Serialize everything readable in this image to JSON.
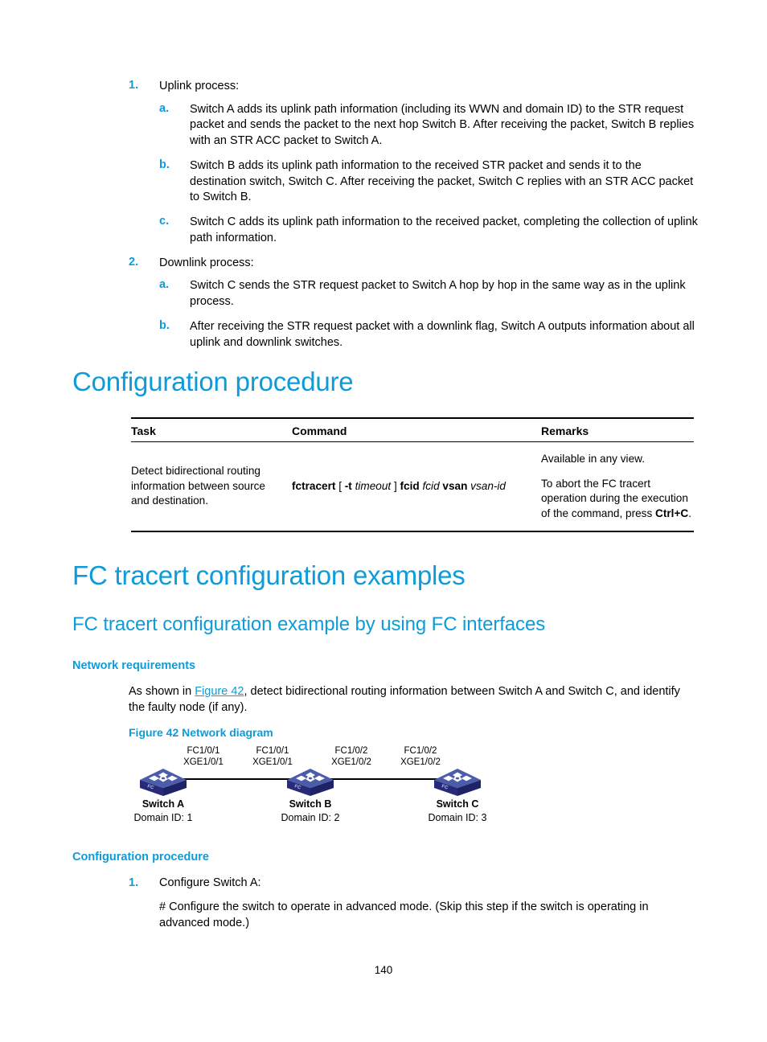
{
  "page": {
    "number": "140"
  },
  "steps_list": [
    {
      "marker": "1.",
      "text": "Uplink process:",
      "sub": [
        {
          "marker": "a.",
          "text": "Switch A adds its uplink path information (including its WWN and domain ID) to the STR request packet and sends the packet to the next hop Switch B. After receiving the packet, Switch B replies with an STR ACC packet to Switch A."
        },
        {
          "marker": "b.",
          "text": "Switch B adds its uplink path information to the received STR packet and sends it to the destination switch, Switch C. After receiving the packet, Switch C replies with an STR ACC packet to Switch B."
        },
        {
          "marker": "c.",
          "text": "Switch C adds its uplink path information to the received packet, completing the collection of uplink path information."
        }
      ]
    },
    {
      "marker": "2.",
      "text": "Downlink process:",
      "sub": [
        {
          "marker": "a.",
          "text": "Switch C sends the STR request packet to Switch A hop by hop in the same way as in the uplink process."
        },
        {
          "marker": "b.",
          "text": "After receiving the STR request packet with a downlink flag, Switch A outputs information about all uplink and downlink switches."
        }
      ]
    }
  ],
  "headings": {
    "config_procedure_1": "Configuration procedure",
    "fc_tracert_examples": "FC tracert configuration examples",
    "fc_tracert_example_fc": "FC tracert configuration example by using FC interfaces",
    "network_requirements": "Network requirements",
    "config_procedure_2": "Configuration procedure"
  },
  "table": {
    "headers": {
      "task": "Task",
      "command": "Command",
      "remarks": "Remarks"
    },
    "row": {
      "task": "Detect bidirectional routing information between source and destination.",
      "command": {
        "cmd": "fctracert",
        "open_bracket": "[",
        "opt_flag": "-t",
        "opt_value": "timeout",
        "close_bracket": "]",
        "kw_fcid": "fcid",
        "val_fcid": "fcid",
        "kw_vsan": "vsan",
        "val_vsan": "vsan-id"
      },
      "remarks": {
        "line1": "Available in any view.",
        "line2_pre": "To abort the FC tracert operation during the execution of the command, press ",
        "line2_key": "Ctrl+C",
        "line2_post": "."
      }
    }
  },
  "network_req_para": {
    "pre": "As shown in ",
    "link": "Figure 42",
    "post": ", detect bidirectional routing information between Switch A and Switch C, and identify the faulty node (if any)."
  },
  "figure": {
    "caption": "Figure 42 Network diagram",
    "port_labels": [
      {
        "line1": "FC1/0/1",
        "line2": "XGE1/0/1"
      },
      {
        "line1": "FC1/0/1",
        "line2": "XGE1/0/1"
      },
      {
        "line1": "FC1/0/2",
        "line2": "XGE1/0/2"
      },
      {
        "line1": "FC1/0/2",
        "line2": "XGE1/0/2"
      }
    ],
    "devices": [
      {
        "name": "Switch A",
        "domain": "Domain ID: 1",
        "badge": "FC"
      },
      {
        "name": "Switch B",
        "domain": "Domain ID: 2",
        "badge": "FC"
      },
      {
        "name": "Switch C",
        "domain": "Domain ID: 3",
        "badge": "FC"
      }
    ],
    "colors": {
      "node_top": "#4b5ca8",
      "node_front": "#262a78",
      "node_side": "#2f3a8c",
      "link": "#000000"
    }
  },
  "config_steps": {
    "step1_marker": "1.",
    "step1_text": "Configure Switch A:",
    "step1_detail": "# Configure the switch to operate in advanced mode. (Skip this step if the switch is operating in advanced mode.)"
  },
  "colors": {
    "accent": "#0d9cd9",
    "text": "#000000"
  }
}
